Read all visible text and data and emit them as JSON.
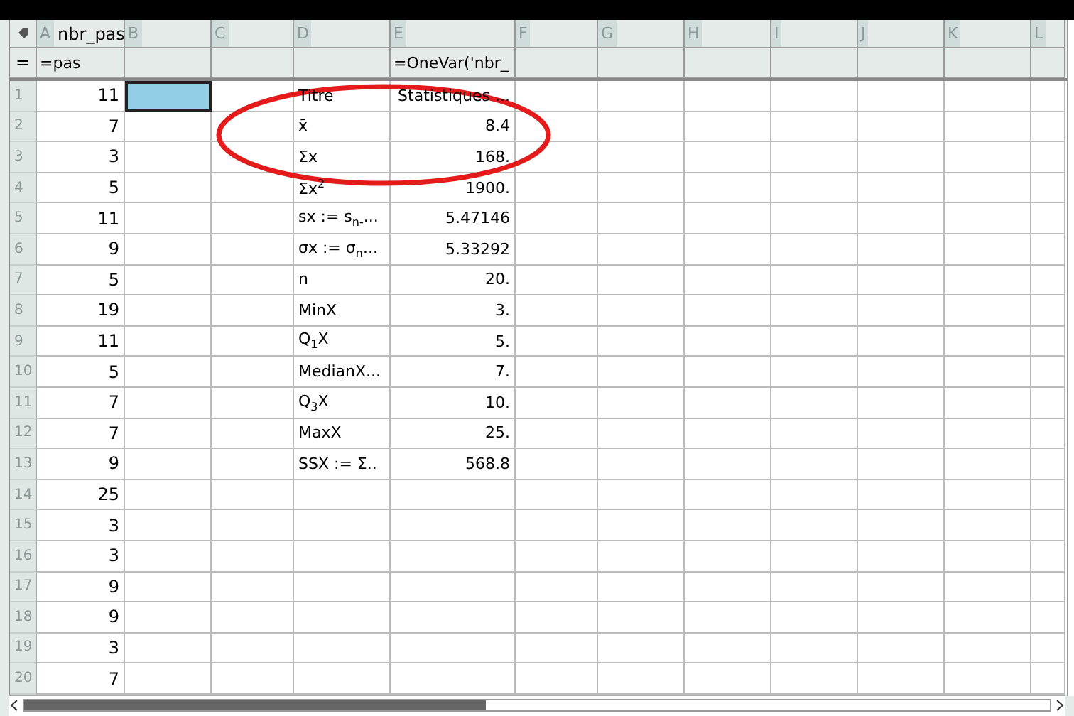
{
  "columns": [
    {
      "letter": "A",
      "name": "nbr_pas",
      "formula": "=pas"
    },
    {
      "letter": "B"
    },
    {
      "letter": "C"
    },
    {
      "letter": "D"
    },
    {
      "letter": "E",
      "formula": "=OneVar('nbr_"
    },
    {
      "letter": "F"
    },
    {
      "letter": "G"
    },
    {
      "letter": "H"
    },
    {
      "letter": "I"
    },
    {
      "letter": "J"
    },
    {
      "letter": "K"
    },
    {
      "letter": "L"
    }
  ],
  "formula_marker": "=",
  "rows": [
    {
      "number": "1",
      "a": "11",
      "d": "Titre",
      "e": "Statistiques ...",
      "selected": true
    },
    {
      "number": "2",
      "a": "7",
      "d": "x̄",
      "e": "8.4",
      "selected": false
    },
    {
      "number": "3",
      "a": "3",
      "d": "Σx",
      "e": "168.",
      "selected": false
    },
    {
      "number": "4",
      "a": "5",
      "d": "Σx$^{2}$",
      "e": "1900.",
      "selected": false
    },
    {
      "number": "5",
      "a": "11",
      "d": "sx := s$_{n-}$...",
      "e": "5.47146",
      "selected": false
    },
    {
      "number": "6",
      "a": "9",
      "d": "σx := σ$_{n}$...",
      "e": "5.33292",
      "selected": false
    },
    {
      "number": "7",
      "a": "5",
      "d": "n",
      "e": "20.",
      "selected": false
    },
    {
      "number": "8",
      "a": "19",
      "d": "MinX",
      "e": "3.",
      "selected": false
    },
    {
      "number": "9",
      "a": "11",
      "d": "Q$_{1}$X",
      "e": "5.",
      "selected": false
    },
    {
      "number": "10",
      "a": "5",
      "d": "MedianX...",
      "e": "7.",
      "selected": false
    },
    {
      "number": "11",
      "a": "7",
      "d": "Q$_{3}$X",
      "e": "10.",
      "selected": false
    },
    {
      "number": "12",
      "a": "7",
      "d": "MaxX",
      "e": "25.",
      "selected": false
    },
    {
      "number": "13",
      "a": "9",
      "d": "SSX := Σ..",
      "e": "568.8",
      "selected": false
    },
    {
      "number": "14",
      "a": "25",
      "selected": false
    },
    {
      "number": "15",
      "a": "3",
      "selected": false
    },
    {
      "number": "16",
      "a": "3",
      "selected": false
    },
    {
      "number": "17",
      "a": "9",
      "selected": false
    },
    {
      "number": "18",
      "a": "9",
      "selected": false
    },
    {
      "number": "19",
      "a": "3",
      "selected": false
    },
    {
      "number": "20",
      "a": "7",
      "selected": false
    }
  ]
}
